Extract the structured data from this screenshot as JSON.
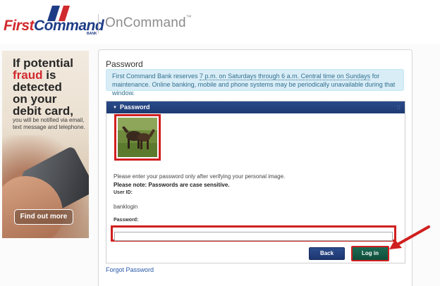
{
  "header": {
    "logo_first": "First",
    "logo_command": "Command",
    "logo_sub": "BANK",
    "app_name": "OnCommand",
    "app_tm": "™"
  },
  "ad": {
    "line1": "If potential",
    "line2_red": "fraud",
    "line2_rest": " is",
    "line3": "detected",
    "line4": "on your",
    "line5": "debit card,",
    "small": "you will be notified via email, text message and telephone.",
    "button": "Find out more"
  },
  "page": {
    "title": "Password",
    "notice_pre": "First Command Bank reserves ",
    "notice_link": "7 p.m. on Saturdays through 6 a.m. Central time on Sundays",
    "notice_post": " for maintenance. Online banking, mobile and phone systems may be periodically unavailable during that window."
  },
  "box": {
    "header": "Password",
    "dots": "::",
    "verify_text": "Please enter your password only after verifying your personal image.",
    "note_text": "Please note: Passwords are case sensitive.",
    "user_label": "User ID:",
    "user_value": "banklogin",
    "password_label": "Password:",
    "password_value": "",
    "back_label": "Back",
    "login_label": "Log in"
  },
  "footer": {
    "forgot": "Forgot Password"
  },
  "colors": {
    "brand_red": "#d02a2e",
    "brand_navy": "#1e3c86",
    "highlight": "#d01f1f",
    "login_green": "#0f4e3a"
  }
}
